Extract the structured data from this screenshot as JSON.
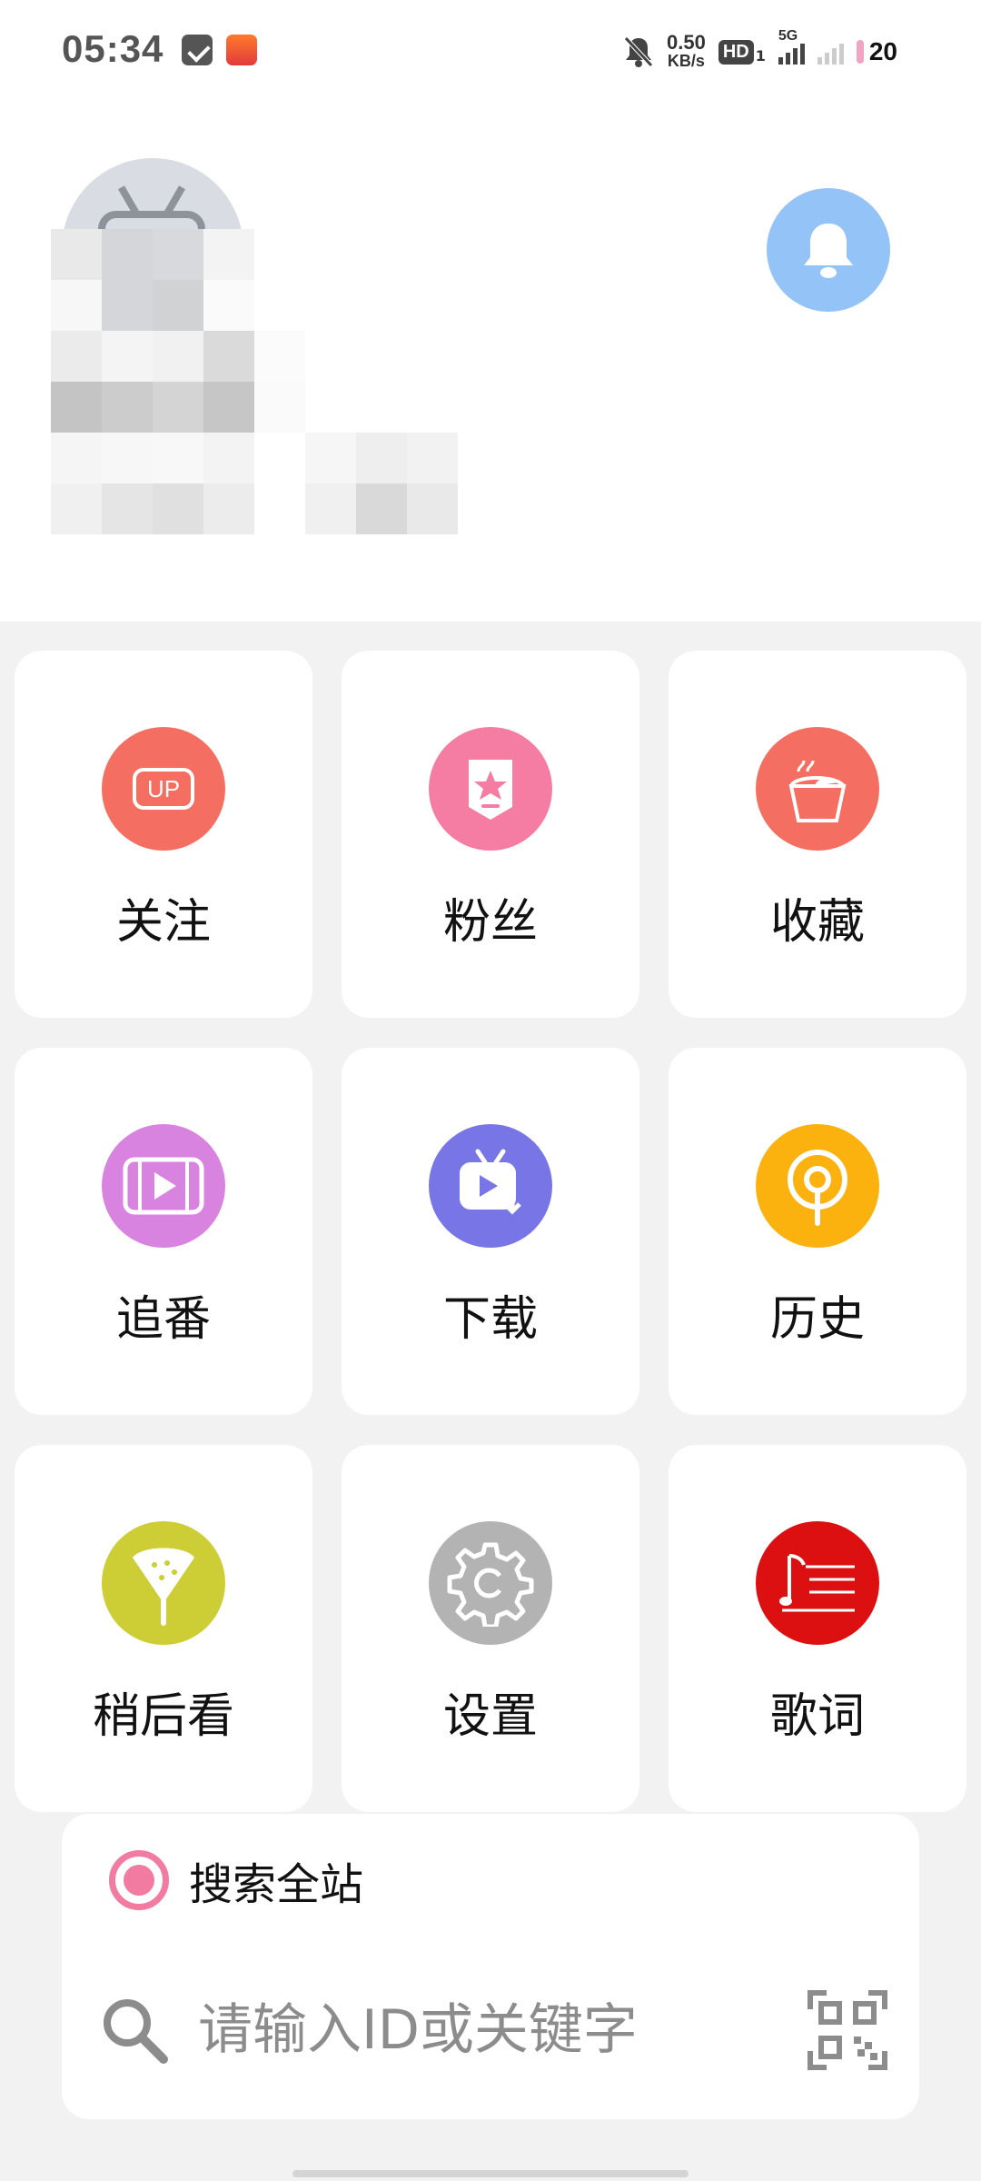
{
  "status_bar": {
    "time": "05:34",
    "net_speed_value": "0.50",
    "net_speed_unit": "KB/s",
    "hd_badge": "HD",
    "hd_sub": "1",
    "network": "5G",
    "battery": "20"
  },
  "profile": {
    "avatar": "bilibili-tv-avatar",
    "name_obscured": true
  },
  "menu": [
    {
      "label": "关注",
      "icon": "up-icon",
      "color": "#f46f61"
    },
    {
      "label": "粉丝",
      "icon": "fan-badge-icon",
      "color": "#f57ca3"
    },
    {
      "label": "收藏",
      "icon": "cup-icon",
      "color": "#f46f61"
    },
    {
      "label": "追番",
      "icon": "film-play-icon",
      "color": "#d883e0"
    },
    {
      "label": "下载",
      "icon": "tv-download-icon",
      "color": "#7875e6"
    },
    {
      "label": "历史",
      "icon": "history-pin-icon",
      "color": "#fbb20f"
    },
    {
      "label": "稍后看",
      "icon": "watermelon-icon",
      "color": "#cdcd35"
    },
    {
      "label": "设置",
      "icon": "gear-icon",
      "color": "#b3b3b3"
    },
    {
      "label": "歌词",
      "icon": "music-sheet-icon",
      "color": "#dc1010"
    }
  ],
  "search": {
    "scope_label": "搜索全站",
    "placeholder": "请输入ID或关键字",
    "value": ""
  },
  "colors": {
    "accent_pink": "#f27ba1",
    "bell_blue": "#93c3f7",
    "background": "#f2f2f2"
  }
}
